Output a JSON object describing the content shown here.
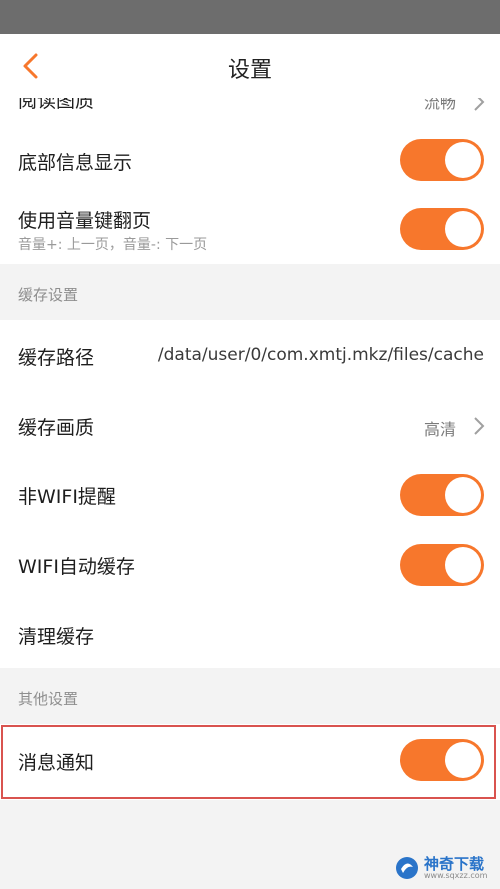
{
  "header": {
    "title": "设置"
  },
  "rows_top": {
    "partial_label": "阅读图质",
    "partial_value": "流畅",
    "bottom_info": "底部信息显示",
    "volume_flip": "使用音量键翻页",
    "volume_flip_sub": "音量+: 上一页，音量-: 下一页"
  },
  "cache_section": {
    "title": "缓存设置",
    "path_label": "缓存路径",
    "path_value": "/data/user/0/com.xmtj.mkz/files/cache",
    "quality_label": "缓存画质",
    "quality_value": "高清",
    "non_wifi_label": "非WIFI提醒",
    "wifi_auto_label": "WIFI自动缓存",
    "clear_label": "清理缓存"
  },
  "other_section": {
    "title": "其他设置",
    "notify_label": "消息通知"
  },
  "toggles": {
    "bottom_info": true,
    "volume_flip": true,
    "non_wifi": true,
    "wifi_auto": true,
    "notify": true
  },
  "colors": {
    "accent": "#f7772c",
    "status_bar": "#6d6d6d",
    "highlight": "#d9534f"
  },
  "watermark": {
    "text": "神奇下载",
    "url": "www.sqxzz.com"
  }
}
